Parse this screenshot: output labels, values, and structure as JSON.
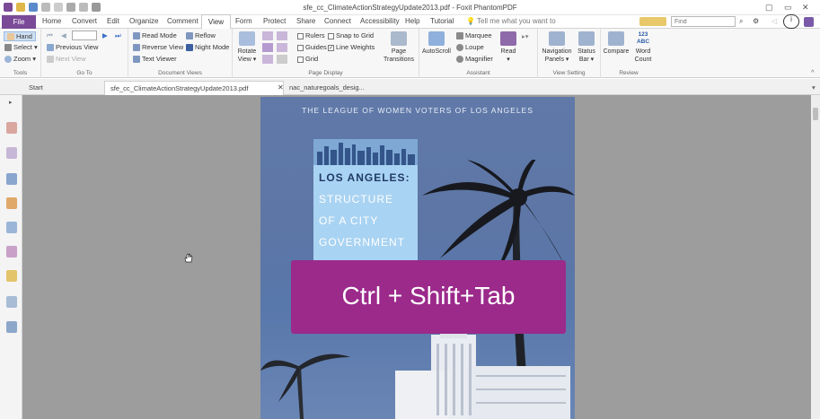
{
  "window": {
    "title": "sfe_cc_ClimateActionStrategyUpdate2013.pdf - Foxit PhantomPDF"
  },
  "menu": {
    "file": "File",
    "tabs": [
      "Home",
      "Convert",
      "Edit",
      "Organize",
      "Comment",
      "View",
      "Form",
      "Protect",
      "Share",
      "Connect",
      "Accessibility",
      "Help",
      "Tutorial"
    ],
    "tell_me": "Tell me what you want to",
    "find_placeholder": "Find"
  },
  "ribbon": {
    "tools": {
      "label": "Tools",
      "hand": "Hand",
      "select": "Select",
      "zoom": "Zoom"
    },
    "goto": {
      "label": "Go To",
      "prev_view": "Previous View",
      "next_view": "Next View"
    },
    "docviews": {
      "label": "Document Views",
      "read_mode": "Read Mode",
      "reverse_view": "Reverse View",
      "text_viewer": "Text Viewer",
      "reflow": "Reflow",
      "night_mode": "Night Mode"
    },
    "pagedisplay": {
      "label": "Page Display",
      "rotate_view": "Rotate View",
      "rulers": "Rulers",
      "guides": "Guides",
      "grid": "Grid",
      "snap_to_grid": "Snap to Grid",
      "line_weights": "Line Weights",
      "page_transitions": "Page Transitions"
    },
    "assistant": {
      "label": "Assistant",
      "autoscroll": "AutoScroll",
      "marquee": "Marquee",
      "loupe": "Loupe",
      "magnifier": "Magnifier",
      "read": "Read"
    },
    "viewsetting": {
      "label": "View Setting",
      "nav_panels": "Navigation Panels",
      "status_bar": "Status Bar"
    },
    "review": {
      "label": "Review",
      "compare": "Compare",
      "word_count": "Word Count",
      "word_count_icon": "123 ABC"
    }
  },
  "doc_tabs": [
    "Start",
    "sfe_cc_ClimateActionStrategyUpdate2013.pdf",
    "nac_naturegoals_desig..."
  ],
  "document": {
    "header": "THE LEAGUE OF WOMEN VOTERS OF LOS ANGELES",
    "title_line1": "LOS ANGELES:",
    "title_line2": "STRUCTURE",
    "title_line3": "OF A CITY",
    "title_line4": "GOVERNMENT"
  },
  "overlay_text": "Ctrl + Shift+Tab",
  "colors": {
    "accent": "#7a4a98",
    "overlay": "#9b2a8b",
    "canvas": "#9d9d9d"
  }
}
